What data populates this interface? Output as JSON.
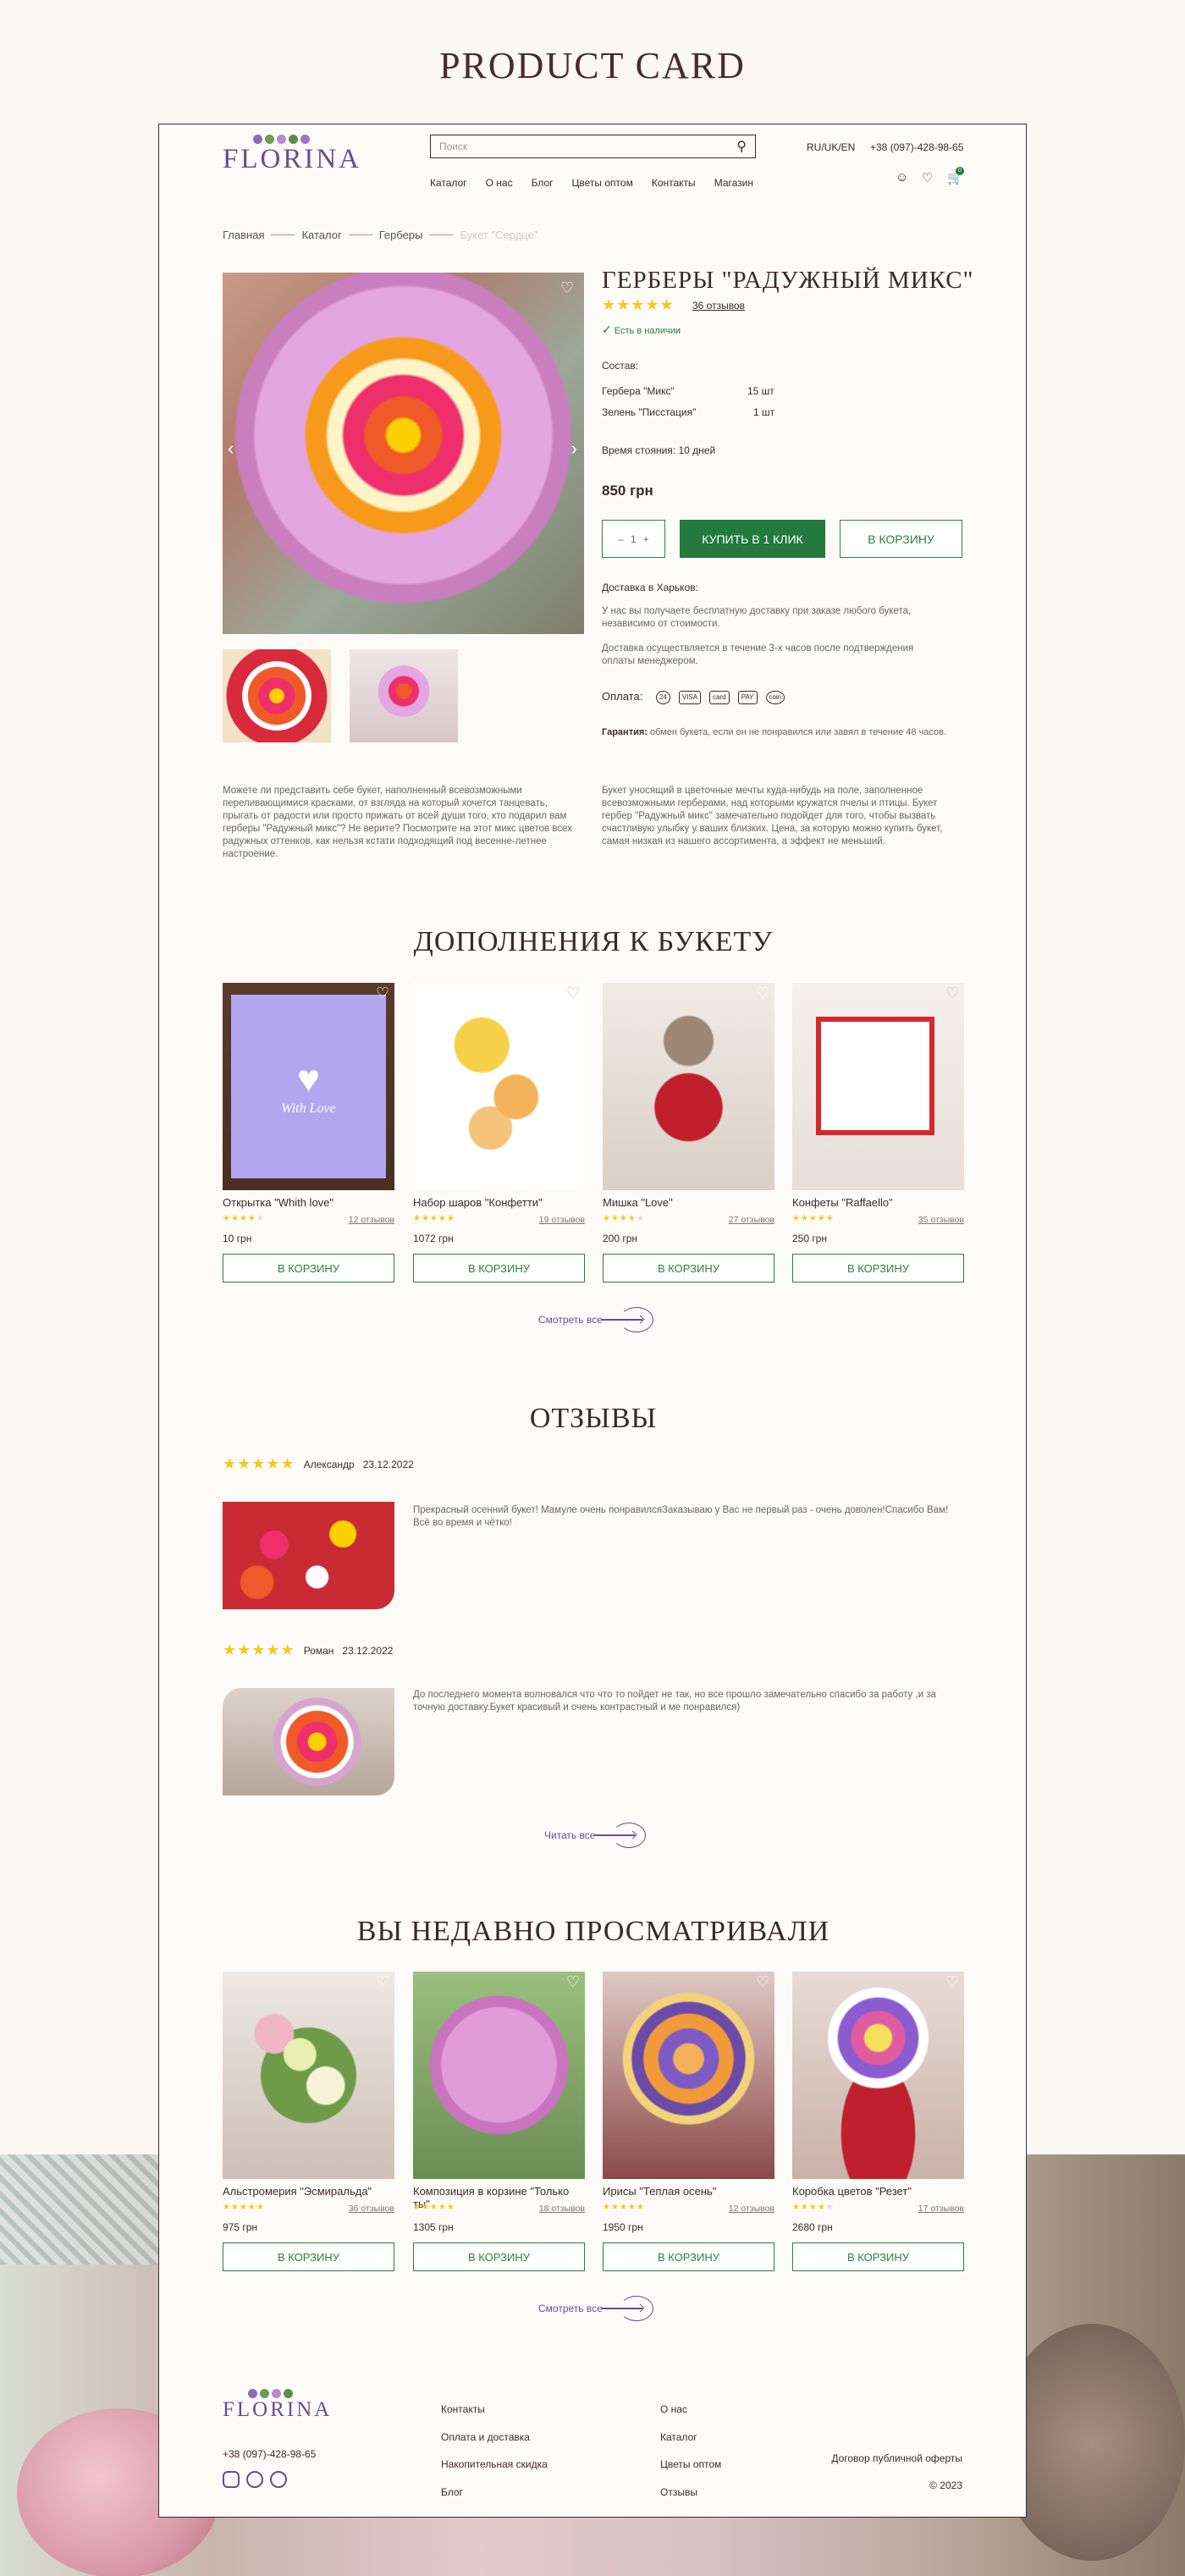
{
  "showcase_title": "PRODUCT CARD",
  "header": {
    "logo": "FLORINA",
    "search_placeholder": "Поиск",
    "lang": "RU/UK/EN",
    "phone": "+38 (097)-428-98-65",
    "cart_count": "0",
    "nav": [
      "Каталог",
      "О нас",
      "Блог",
      "Цветы оптом",
      "Контакты",
      "Магазин"
    ]
  },
  "breadcrumbs": [
    "Главная",
    "Каталог",
    "Герберы",
    "Букет \"Сердце\""
  ],
  "product": {
    "title": "ГЕРБЕРЫ \"РАДУЖНЫЙ МИКС\"",
    "rating": 5,
    "reviews": "36 отзывов",
    "in_stock": "Есть в наличии",
    "composition_label": "Состав:",
    "composition": [
      {
        "name": "Гербера \"Микс\"",
        "qty": "15 шт"
      },
      {
        "name": "Зелень \"Писстация\"",
        "qty": "1 шт"
      }
    ],
    "lifetime": "Время стояния: 10 дней",
    "price": "850 грн",
    "qty": "1",
    "buy_one_click": "КУПИТЬ В 1 КЛИК",
    "to_cart": "В КОРЗИНУ",
    "delivery_label": "Доставка в Харьков:",
    "delivery_1": "У нас вы получаете бесплатную доставку при заказе любого букета, независимо от стоимости.",
    "delivery_2": "Доставка осуществляется в течение 3-х часов после подтверждения оплаты менеджером.",
    "payment_label": "Оплата:",
    "payment_icons": [
      "24",
      "VISA",
      "card",
      "PAY",
      "coin"
    ],
    "guarantee_label": "Гарантия:",
    "guarantee": "обмен букета, если он не понравился или завял в течение 48 часов.",
    "desc_left": "Можете ли представить себе букет, наполненный всевозможными переливающимися красками, от взгляда на который хочется танцевать, прыгать от радости или просто прижать от всей души того, кто подарил вам герберы \"Радужный микс\"? Не верите? Посмотрите на этот микс цветов всех радужных оттенков, как нельзя кстати подходящий под весенне-летнее настроение.",
    "desc_right": "Букет уносящий в цветочные мечты куда-нибудь на поле, заполненное всевозможными герберами, над которыми кружатся пчелы и птицы. Букет гербер \"Радужный микс\" замечательно подойдет для того, чтобы вызвать счастливую улыбку у ваших близких. Цена, за которую можно купить букет, самая низкая из нашего ассортимента, а эффект не меньший."
  },
  "addons": {
    "title": "ДОПОЛНЕНИЯ К БУКЕТУ",
    "more": "Смотреть все",
    "items": [
      {
        "name": "Открытка \"Whith love\"",
        "reviews": "12 отзывов",
        "price": "10 грн",
        "button": "В КОРЗИНУ",
        "rating": 4
      },
      {
        "name": "Набор шаров \"Конфетти\"",
        "reviews": "19 отзывов",
        "price": "1072 грн",
        "button": "В КОРЗИНУ",
        "rating": 5
      },
      {
        "name": "Мишка \"Love\"",
        "reviews": "27 отзывов",
        "price": "200 грн",
        "button": "В КОРЗИНУ",
        "rating": 4
      },
      {
        "name": "Конфеты \"Raffaello\"",
        "reviews": "35 отзывов",
        "price": "250 грн",
        "button": "В КОРЗИНУ",
        "rating": 5
      }
    ]
  },
  "reviews": {
    "title": "ОТЗЫВЫ",
    "more": "Читать все",
    "items": [
      {
        "author": "Александр",
        "date": "23.12.2022",
        "rating": 5,
        "text": "Прекрасный осенний букет! Мамуле очень понравилсяЗаказываю у Вас не первый раз - очень доволен!Спасибо Вам! Всё во время и чётко!"
      },
      {
        "author": "Роман",
        "date": "23.12.2022",
        "rating": 5,
        "text": "До последнего момента волновался что что то пойдет не так, но все прошло замечательно спасибо за работу ,и за точную доставку.Букет красивый и очень контрастный и ме понравился)"
      }
    ]
  },
  "recent": {
    "title": "ВЫ НЕДАВНО ПРОСМАТРИВАЛИ",
    "more": "Смотреть все",
    "items": [
      {
        "name": "Альстромерия \"Эсмиральда\"",
        "reviews": "36 отзывов",
        "price": "975 грн",
        "button": "В КОРЗИНУ",
        "rating": 5
      },
      {
        "name": "Композиция в корзине \"Только ты\"",
        "reviews": "18 отзывов",
        "price": "1305 грн",
        "button": "В КОРЗИНУ",
        "rating": 5
      },
      {
        "name": "Ирисы \"Теплая осень\"",
        "reviews": "12 отзывов",
        "price": "1950 грн",
        "button": "В КОРЗИНУ",
        "rating": 5
      },
      {
        "name": "Коробка цветов \"Резет\"",
        "reviews": "17 отзывов",
        "price": "2680 грн",
        "button": "В КОРЗИНУ",
        "rating": 4
      }
    ]
  },
  "footer": {
    "logo": "FLORINA",
    "phone": "+38 (097)-428-98-65",
    "col1": [
      "Контакты",
      "Оплата и доставка",
      "Накопительная скидка",
      "Блог"
    ],
    "col2": [
      "О нас",
      "Каталог",
      "Цветы оптом",
      "Отзывы"
    ],
    "offer": "Договор публичной оферты",
    "copyright": "© 2023"
  },
  "colors": {
    "accent_green": "#24793f",
    "brand_purple": "#6a4c93",
    "star": "#f3c81f"
  }
}
